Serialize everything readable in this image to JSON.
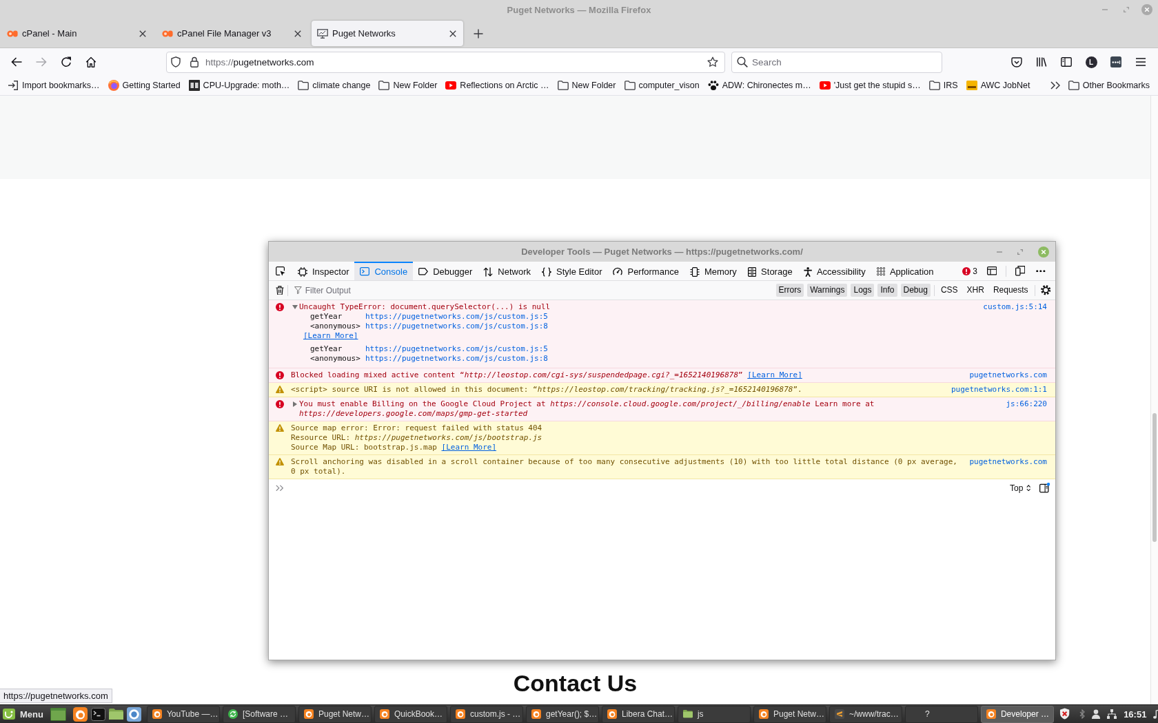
{
  "window": {
    "title": "Puget Networks — Mozilla Firefox"
  },
  "tabs": [
    {
      "label": "cPanel - Main",
      "kind": "cpanel",
      "selected": false
    },
    {
      "label": "cPanel File Manager v3",
      "kind": "cpanel",
      "selected": false
    },
    {
      "label": "Puget Networks",
      "kind": "site",
      "selected": true
    }
  ],
  "nav_buttons": [
    {
      "kind": "back",
      "disabled": false
    },
    {
      "kind": "forward",
      "disabled": true
    },
    {
      "kind": "reload",
      "disabled": false
    },
    {
      "kind": "home",
      "disabled": false
    }
  ],
  "address_bar": {
    "scheme": "https://",
    "host": "pugetnetworks.com"
  },
  "search": {
    "placeholder": "Search"
  },
  "account": {
    "initial": "L"
  },
  "bookmarks": [
    {
      "label": "Import bookmarks…",
      "kind": "import"
    },
    {
      "label": "Getting Started",
      "kind": "browser"
    },
    {
      "label": "CPU-Upgrade: moth…",
      "kind": "site"
    },
    {
      "label": "climate change",
      "kind": "folder"
    },
    {
      "label": "New Folder",
      "kind": "folder"
    },
    {
      "label": "Reflections on Arctic …",
      "kind": "video"
    },
    {
      "label": "New Folder",
      "kind": "folder"
    },
    {
      "label": "computer_vison",
      "kind": "folder"
    },
    {
      "label": "ADW: Chironectes m…",
      "kind": "paw"
    },
    {
      "label": "'Just get the stupid s…",
      "kind": "video"
    },
    {
      "label": "IRS",
      "kind": "folder"
    },
    {
      "label": "AWC JobNet",
      "kind": "awc"
    }
  ],
  "other_bookmarks": {
    "label": "Other Bookmarks"
  },
  "page": {
    "heading": "Contact Us",
    "status_url": "https://pugetnetworks.com"
  },
  "devtools": {
    "title": "Developer Tools — Puget Networks — https://pugetnetworks.com/",
    "tools": [
      {
        "label": "Inspector",
        "kind": "inspector",
        "selected": false
      },
      {
        "label": "Console",
        "kind": "console",
        "selected": true
      },
      {
        "label": "Debugger",
        "kind": "debugger",
        "selected": false
      },
      {
        "label": "Network",
        "kind": "network",
        "selected": false
      },
      {
        "label": "Style Editor",
        "kind": "style_editor",
        "selected": false
      },
      {
        "label": "Performance",
        "kind": "performance",
        "selected": false
      },
      {
        "label": "Memory",
        "kind": "memory",
        "selected": false
      },
      {
        "label": "Storage",
        "kind": "storage",
        "selected": false
      },
      {
        "label": "Accessibility",
        "kind": "accessibility",
        "selected": false
      },
      {
        "label": "Application",
        "kind": "application",
        "selected": false
      }
    ],
    "error_count": "3",
    "filter": {
      "placeholder": "Filter Output"
    },
    "level_filters": [
      {
        "label": "Errors",
        "on": true
      },
      {
        "label": "Warnings",
        "on": true
      },
      {
        "label": "Logs",
        "on": true
      },
      {
        "label": "Info",
        "on": true
      },
      {
        "label": "Debug",
        "on": true
      }
    ],
    "type_filters": [
      {
        "label": "CSS",
        "on": false
      },
      {
        "label": "XHR",
        "on": false
      },
      {
        "label": "Requests",
        "on": false
      }
    ],
    "messages": [
      {
        "kind": "error",
        "expanded": true,
        "lines": [
          "Uncaught TypeError: document.querySelector(...) is null"
        ],
        "location": "custom.js:5:14",
        "details": [
          {
            "kind": "stack",
            "frames": [
              {
                "function": "getYear",
                "url": "https://pugetnetworks.com/js/custom.js:5"
              },
              {
                "function": "<anonymous>",
                "url": "https://pugetnetworks.com/js/custom.js:8"
              }
            ]
          },
          {
            "kind": "link",
            "label": "[Learn More]"
          },
          {
            "kind": "stack",
            "frames": [
              {
                "function": "getYear",
                "url": "https://pugetnetworks.com/js/custom.js:5"
              },
              {
                "function": "<anonymous>",
                "url": "https://pugetnetworks.com/js/custom.js:8"
              }
            ]
          }
        ]
      },
      {
        "kind": "error",
        "lines": [
          "Blocked loading mixed active content “*http://leostop.com/cgi-sys/suspendedpage.cgi?_=1652140196878*”"
        ],
        "link": "[Learn More]",
        "location": "pugetnetworks.com"
      },
      {
        "kind": "warning",
        "lines": [
          "<script> source URI is not allowed in this document: “*https://leostop.com/tracking/tracking.js?_=1652140196878*”."
        ],
        "location": "pugetnetworks.com:1:1"
      },
      {
        "kind": "error",
        "expanded": false,
        "lines": [
          "You must enable Billing on the Google Cloud Project at *https://console.cloud.google.com/project/_/billing/enable* Learn more at *https://developers.google.com/maps/gmp-get-started*"
        ],
        "location": "js:66:220"
      },
      {
        "kind": "warning",
        "lines": [
          "Source map error: Error: request failed with status 404",
          "Resource URL: *https://pugetnetworks.com/js/bootstrap.js*",
          "Source Map URL: bootstrap.js.map"
        ],
        "link": "[Learn More]"
      },
      {
        "kind": "warning",
        "lines": [
          "Scroll anchoring was disabled in a scroll container because of too many consecutive adjustments (10) with too little total distance (0 px average, 0 px total)."
        ],
        "location": "pugetnetworks.com"
      }
    ],
    "context": {
      "label": "Top"
    }
  },
  "taskbar": {
    "menu": "Menu",
    "windows": [
      {
        "label": "YouTube —…",
        "kind": "browser",
        "selected": false
      },
      {
        "label": "[Software …",
        "kind": "updater",
        "selected": false
      },
      {
        "label": "Puget Netw…",
        "kind": "browser",
        "selected": false
      },
      {
        "label": "QuickBook…",
        "kind": "browser",
        "selected": false
      },
      {
        "label": "custom.js - …",
        "kind": "browser",
        "selected": false
      },
      {
        "label": "getYear(); $…",
        "kind": "browser",
        "selected": false
      },
      {
        "label": "Libera Chat…",
        "kind": "browser",
        "selected": false
      },
      {
        "label": "js",
        "kind": "files",
        "selected": false
      },
      {
        "label": "Puget Netw…",
        "kind": "browser",
        "selected": false
      },
      {
        "label": "~/www/trac…",
        "kind": "editor",
        "selected": false
      },
      {
        "label": "?",
        "kind": "blank",
        "selected": false
      },
      {
        "label": "Developer …",
        "kind": "browser",
        "selected": true
      }
    ],
    "clock": "16:51"
  }
}
